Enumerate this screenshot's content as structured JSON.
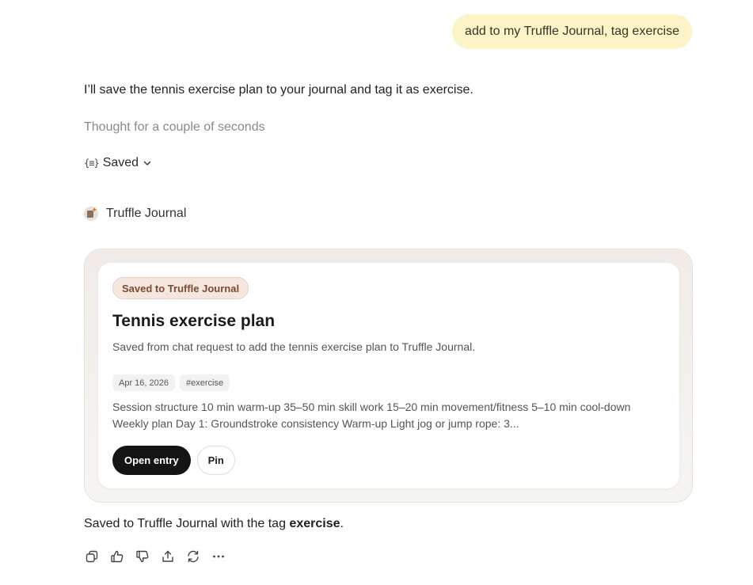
{
  "user_message": "add to my Truffle Journal, tag exercise",
  "assistant": {
    "intro": "I’ll save the tennis exercise plan to your journal and tag it as exercise.",
    "thought": "Thought for a couple of seconds",
    "saved_toggle": {
      "glyph": "{≡}",
      "label": "Saved"
    },
    "app_name": "Truffle Journal",
    "card": {
      "badge": "Saved to Truffle Journal",
      "title": "Tennis exercise plan",
      "description": "Saved from chat request to add the tennis exercise plan to Truffle Journal.",
      "date_chip": "Apr 16, 2026",
      "tag_chip": "#exercise",
      "preview_line1": "Session structure 10 min warm-up 35–50 min skill work 15–20 min movement/fitness 5–10 min cool-down",
      "preview_line2": "Weekly plan Day 1: Groundstroke consistency Warm-up Light jog or jump rope: 3...",
      "open_label": "Open entry",
      "pin_label": "Pin"
    },
    "summary": {
      "prefix": "Saved to Truffle Journal with the tag ",
      "tag": "exercise",
      "suffix": "."
    }
  },
  "toolbar_icons": [
    "copy-icon",
    "thumbs-up-icon",
    "thumbs-down-icon",
    "share-icon",
    "regenerate-icon",
    "more-icon"
  ],
  "colors": {
    "user_bubble": "#fdf3c9",
    "badge_bg": "#f5e6df",
    "badge_text": "#7a4a33",
    "primary_button": "#141414"
  }
}
